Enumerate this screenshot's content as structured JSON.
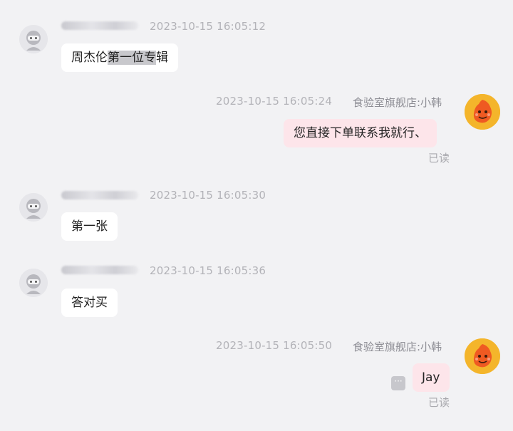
{
  "messages": [
    {
      "side": "left",
      "time": "2023-10-15 16:05:12",
      "text_pre": "周杰伦",
      "text_hl": "第一位专",
      "text_post": "辑"
    },
    {
      "side": "right",
      "time": "2023-10-15 16:05:24",
      "sender": "食验室旗舰店:小韩",
      "text": "您直接下单联系我就行、",
      "status": "已读"
    },
    {
      "side": "left",
      "time": "2023-10-15 16:05:30",
      "text": "第一张"
    },
    {
      "side": "left",
      "time": "2023-10-15 16:05:36",
      "text": "答对买"
    },
    {
      "side": "right",
      "time": "2023-10-15 16:05:50",
      "sender": "食验室旗舰店:小韩",
      "text": "Jay",
      "status": "已读"
    }
  ],
  "more_button_glyph": "···"
}
